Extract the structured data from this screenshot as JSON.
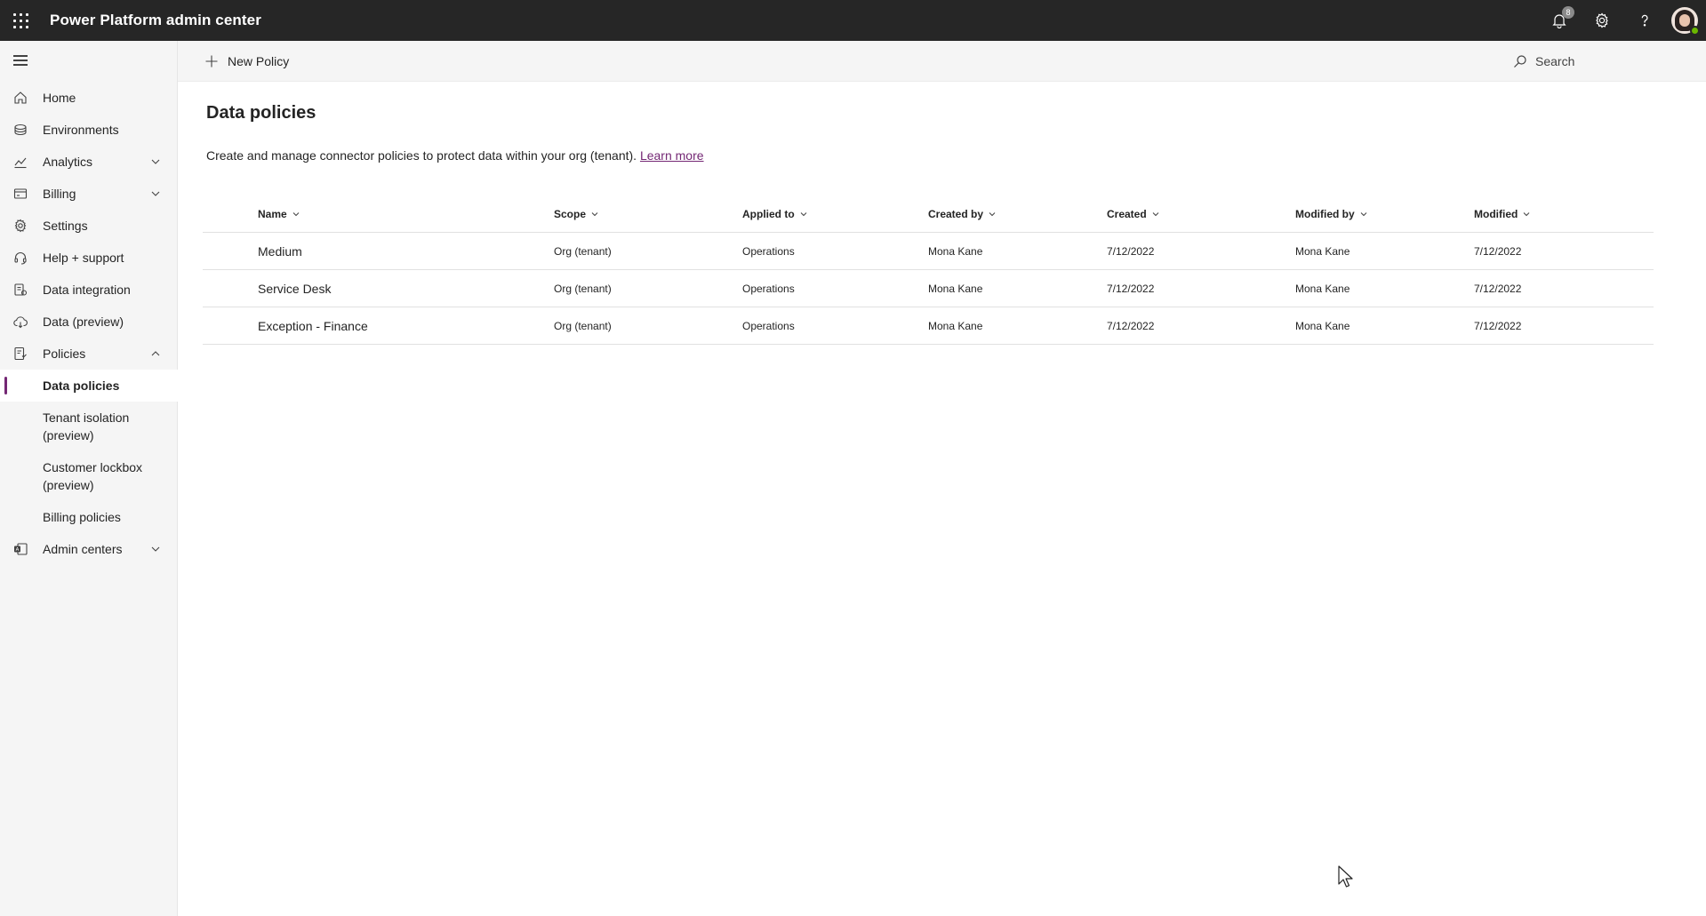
{
  "topbar": {
    "title": "Power Platform admin center",
    "notification_count": "8",
    "icons": [
      "waffle-icon",
      "bell-icon",
      "gear-icon",
      "help-icon",
      "avatar"
    ]
  },
  "sidebar": {
    "items": [
      {
        "label": "Home",
        "icon": "home-icon"
      },
      {
        "label": "Environments",
        "icon": "environments-icon"
      },
      {
        "label": "Analytics",
        "icon": "analytics-icon",
        "expandable": true
      },
      {
        "label": "Billing",
        "icon": "billing-icon",
        "expandable": true
      },
      {
        "label": "Settings",
        "icon": "gear-icon"
      },
      {
        "label": "Help + support",
        "icon": "headset-icon"
      },
      {
        "label": "Data integration",
        "icon": "data-integration-icon"
      },
      {
        "label": "Data (preview)",
        "icon": "cloud-data-icon"
      },
      {
        "label": "Policies",
        "icon": "policies-icon",
        "expanded": true
      },
      {
        "label": "Data policies",
        "selected": true
      },
      {
        "label": "Tenant isolation (preview)"
      },
      {
        "label": "Customer lockbox (preview)"
      },
      {
        "label": "Billing policies"
      },
      {
        "label": "Admin centers",
        "icon": "admin-centers-icon",
        "expandable": true
      }
    ]
  },
  "toolbar": {
    "new_policy_label": "New Policy",
    "search_label": "Search"
  },
  "main": {
    "title": "Data policies",
    "description": "Create and manage connector policies to protect data within your org (tenant). ",
    "learn_more": "Learn more"
  },
  "table": {
    "columns": [
      "Name",
      "Scope",
      "Applied to",
      "Created by",
      "Created",
      "Modified by",
      "Modified"
    ],
    "rows": [
      [
        "Medium",
        "Org (tenant)",
        "Operations",
        "Mona Kane",
        "7/12/2022",
        "Mona Kane",
        "7/12/2022"
      ],
      [
        "Service Desk",
        "Org (tenant)",
        "Operations",
        "Mona Kane",
        "7/12/2022",
        "Mona Kane",
        "7/12/2022"
      ],
      [
        "Exception - Finance",
        "Org (tenant)",
        "Operations",
        "Mona Kane",
        "7/12/2022",
        "Mona Kane",
        "7/12/2022"
      ]
    ]
  },
  "colors": {
    "topbar_bg": "#262626",
    "accent": "#742774",
    "sidebar_bg": "#f5f5f5"
  }
}
